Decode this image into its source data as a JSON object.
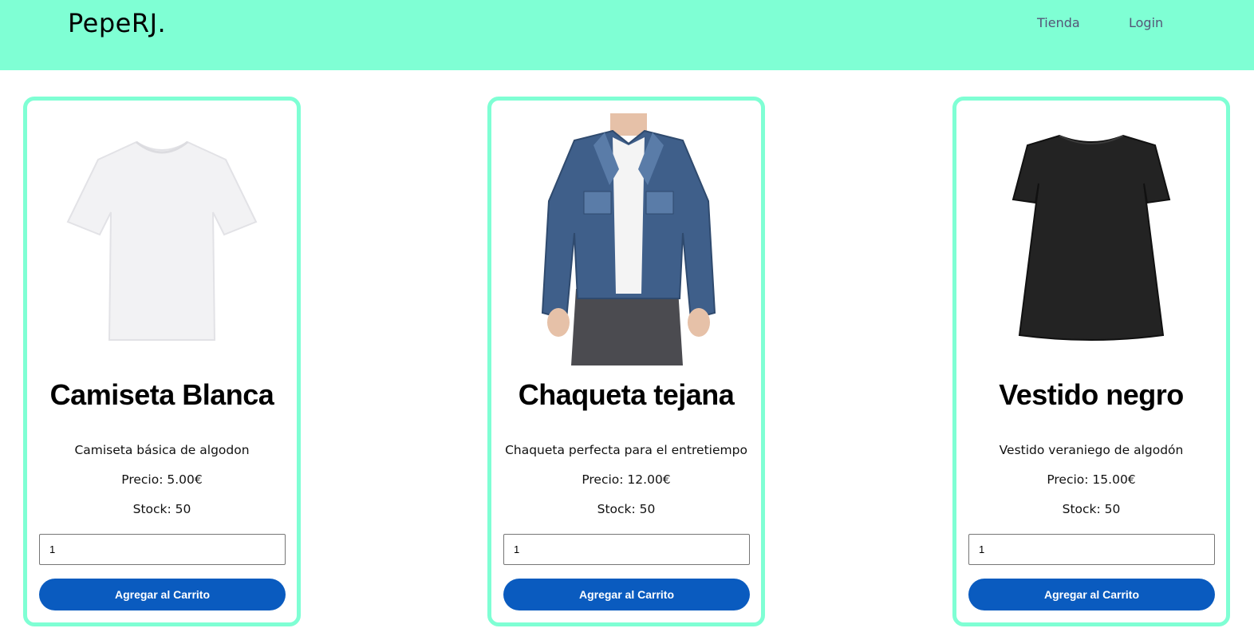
{
  "header": {
    "brand": "PepeRJ.",
    "nav": {
      "tienda": "Tienda",
      "login": "Login"
    },
    "bg_color": "#7fffd4"
  },
  "products": [
    {
      "name": "Camiseta Blanca",
      "description": "Camiseta básica de algodon",
      "price": "Precio: 5.00€",
      "stock": "Stock: 50",
      "quantity": "1",
      "button": "Agregar al Carrito",
      "image": "white-tshirt"
    },
    {
      "name": "Chaqueta tejana",
      "description": "Chaqueta perfecta para el entretiempo",
      "price": "Precio: 12.00€",
      "stock": "Stock: 50",
      "quantity": "1",
      "button": "Agregar al Carrito",
      "image": "denim-jacket"
    },
    {
      "name": "Vestido negro",
      "description": "Vestido veraniego de algodón",
      "price": "Precio: 15.00€",
      "stock": "Stock: 50",
      "quantity": "1",
      "button": "Agregar al Carrito",
      "image": "black-dress"
    }
  ],
  "colors": {
    "accent": "#7fffd4",
    "button": "#0a5bbf"
  }
}
